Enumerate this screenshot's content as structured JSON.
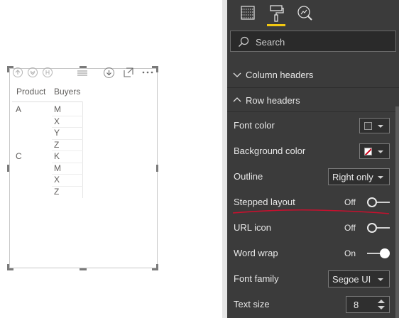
{
  "visual": {
    "table": {
      "headers": [
        "Product",
        "Buyers"
      ],
      "rows": [
        {
          "product": "A",
          "buyer": "M"
        },
        {
          "product": "",
          "buyer": "X"
        },
        {
          "product": "",
          "buyer": "Y"
        },
        {
          "product": "",
          "buyer": "Z"
        },
        {
          "product": "C",
          "buyer": "K"
        },
        {
          "product": "",
          "buyer": "M"
        },
        {
          "product": "",
          "buyer": "X"
        },
        {
          "product": "",
          "buyer": "Z"
        }
      ]
    },
    "toolbar_icons": [
      "drill-up-icon",
      "drill-down-icon",
      "expand-level-icon",
      "drag-grip-icon",
      "drill-mode-icon",
      "focus-mode-icon",
      "more-options-icon"
    ]
  },
  "pane": {
    "tabs": [
      {
        "name": "fields-tab",
        "icon": "table-fields-icon"
      },
      {
        "name": "format-tab",
        "icon": "paint-roller-icon",
        "active": true
      },
      {
        "name": "analytics-tab",
        "icon": "analytics-magnifier-icon"
      }
    ],
    "search": {
      "placeholder": "Search"
    },
    "sections": {
      "column_headers": "Column headers",
      "row_headers": "Row headers"
    },
    "rows": {
      "font_color": {
        "label": "Font color",
        "swatch": "#3b3b3b"
      },
      "background_color": {
        "label": "Background color"
      },
      "outline": {
        "label": "Outline",
        "value": "Right only"
      },
      "stepped_layout": {
        "label": "Stepped layout",
        "state": "Off"
      },
      "url_icon": {
        "label": "URL icon",
        "state": "Off"
      },
      "word_wrap": {
        "label": "Word wrap",
        "state": "On"
      },
      "font_family": {
        "label": "Font family",
        "value": "Segoe UI"
      },
      "text_size": {
        "label": "Text size",
        "value": "8"
      }
    },
    "accent_color": "#f2c811",
    "annotation_color": "#c8102e"
  }
}
